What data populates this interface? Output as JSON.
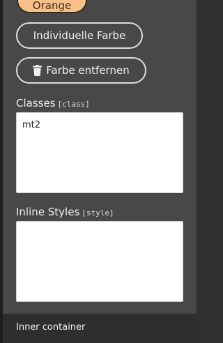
{
  "buttons": {
    "orange_label": "Orange",
    "individual_label": "Individuelle Farbe",
    "remove_label": "Farbe entfernen"
  },
  "classes": {
    "label": "Classes",
    "attr": "[class]",
    "value": "mt2"
  },
  "inline_styles": {
    "label": "Inline Styles",
    "attr": "[style]",
    "value": ""
  },
  "footer": {
    "label": "Inner container"
  },
  "icons": {
    "remove": "trash-icon"
  },
  "colors": {
    "orange_button": "#f7c08a",
    "panel_background": "#484848",
    "footer_background": "#2e2e2e"
  }
}
